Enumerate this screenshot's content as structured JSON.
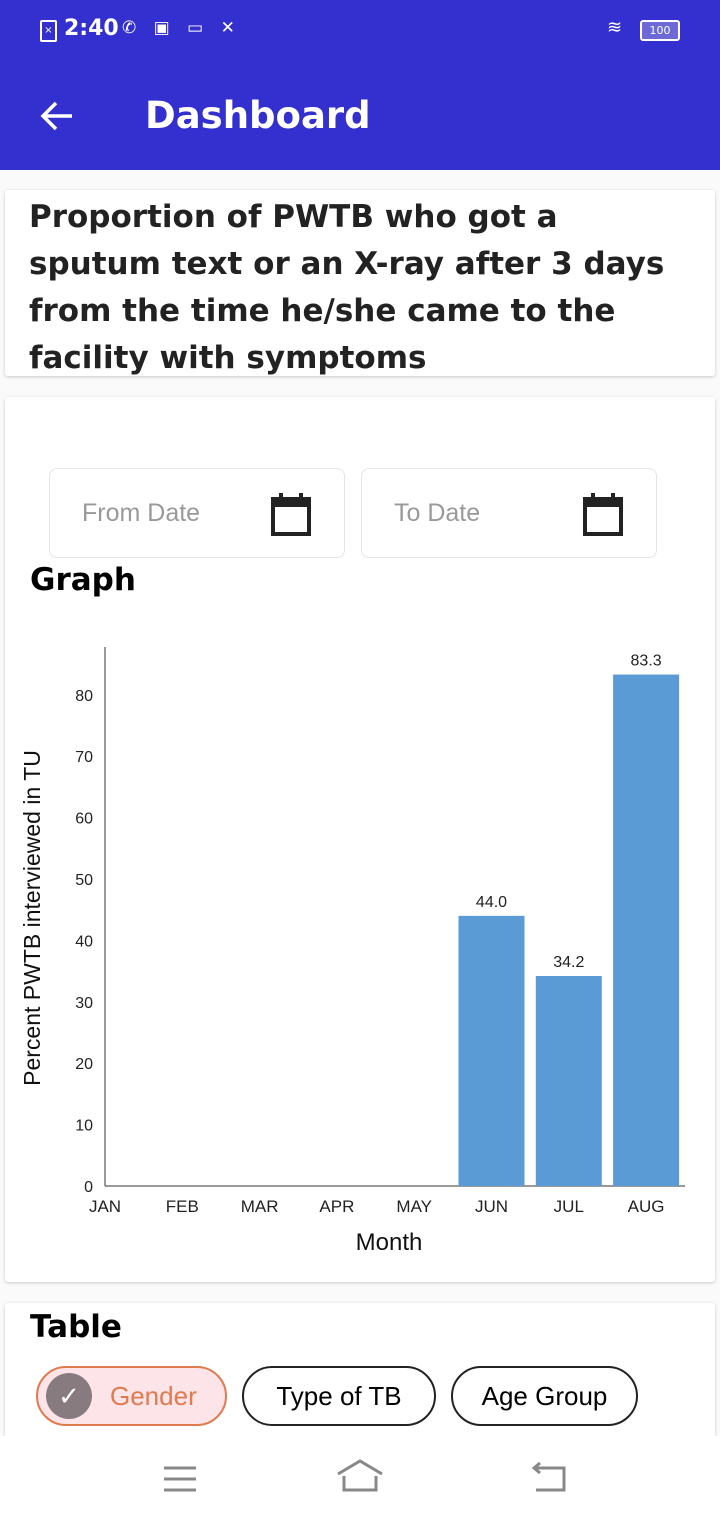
{
  "status_bar": {
    "time": "2:40",
    "battery": "100"
  },
  "app_bar": {
    "title": "Dashboard"
  },
  "indicator": {
    "title": "Proportion of PWTB who got a sputum text or an X-ray after 3 days from the time he/she came to the facility with symptoms"
  },
  "filters": {
    "from_placeholder": "From Date",
    "to_placeholder": "To Date"
  },
  "graph": {
    "heading": "Graph"
  },
  "chart_data": {
    "type": "bar",
    "categories": [
      "JAN",
      "FEB",
      "MAR",
      "APR",
      "MAY",
      "JUN",
      "JUL",
      "AUG"
    ],
    "values": [
      null,
      null,
      null,
      null,
      null,
      44.0,
      34.2,
      83.3
    ],
    "value_labels": [
      "",
      "",
      "",
      "",
      "",
      "44.0",
      "34.2",
      "83.3"
    ],
    "xlabel": "Month",
    "ylabel": "Percent PWTB interviewed in TU",
    "ylim": [
      0,
      88
    ],
    "yticks": [
      0,
      10,
      20,
      30,
      40,
      50,
      60,
      70,
      80
    ],
    "bar_color": "#5b9bd5",
    "grid": false
  },
  "table": {
    "heading": "Table",
    "chips": [
      {
        "label": "Gender",
        "selected": true
      },
      {
        "label": "Type of TB",
        "selected": false
      },
      {
        "label": "Age Group",
        "selected": false
      }
    ]
  },
  "colors": {
    "primary": "#3430cf",
    "chip_selected_border": "#e07a4f",
    "chip_selected_bg": "#fde4e8"
  }
}
